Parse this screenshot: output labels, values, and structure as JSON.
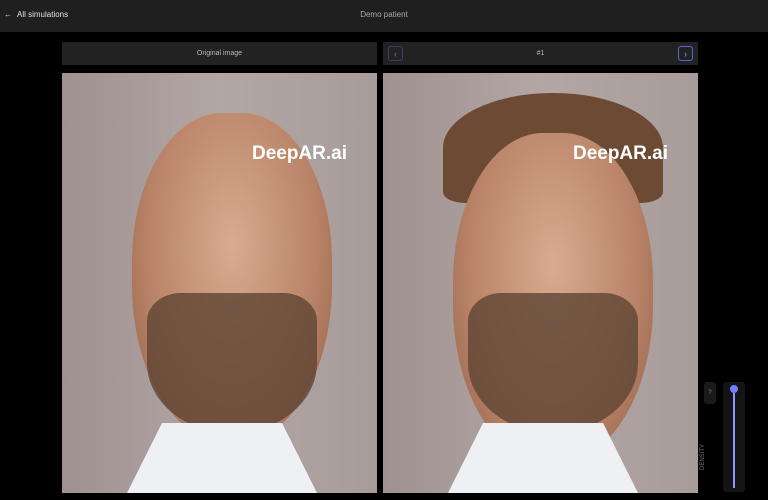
{
  "header": {
    "back_label": "All simulations",
    "title": "Demo patient"
  },
  "panels": {
    "original_label": "Original image",
    "simulation_label": "#1",
    "watermark": "DeepAR.ai"
  },
  "controls": {
    "help_label": "?",
    "density_label": "DENSITY",
    "density_value_percent": 100,
    "accent": "#6f7dff"
  }
}
